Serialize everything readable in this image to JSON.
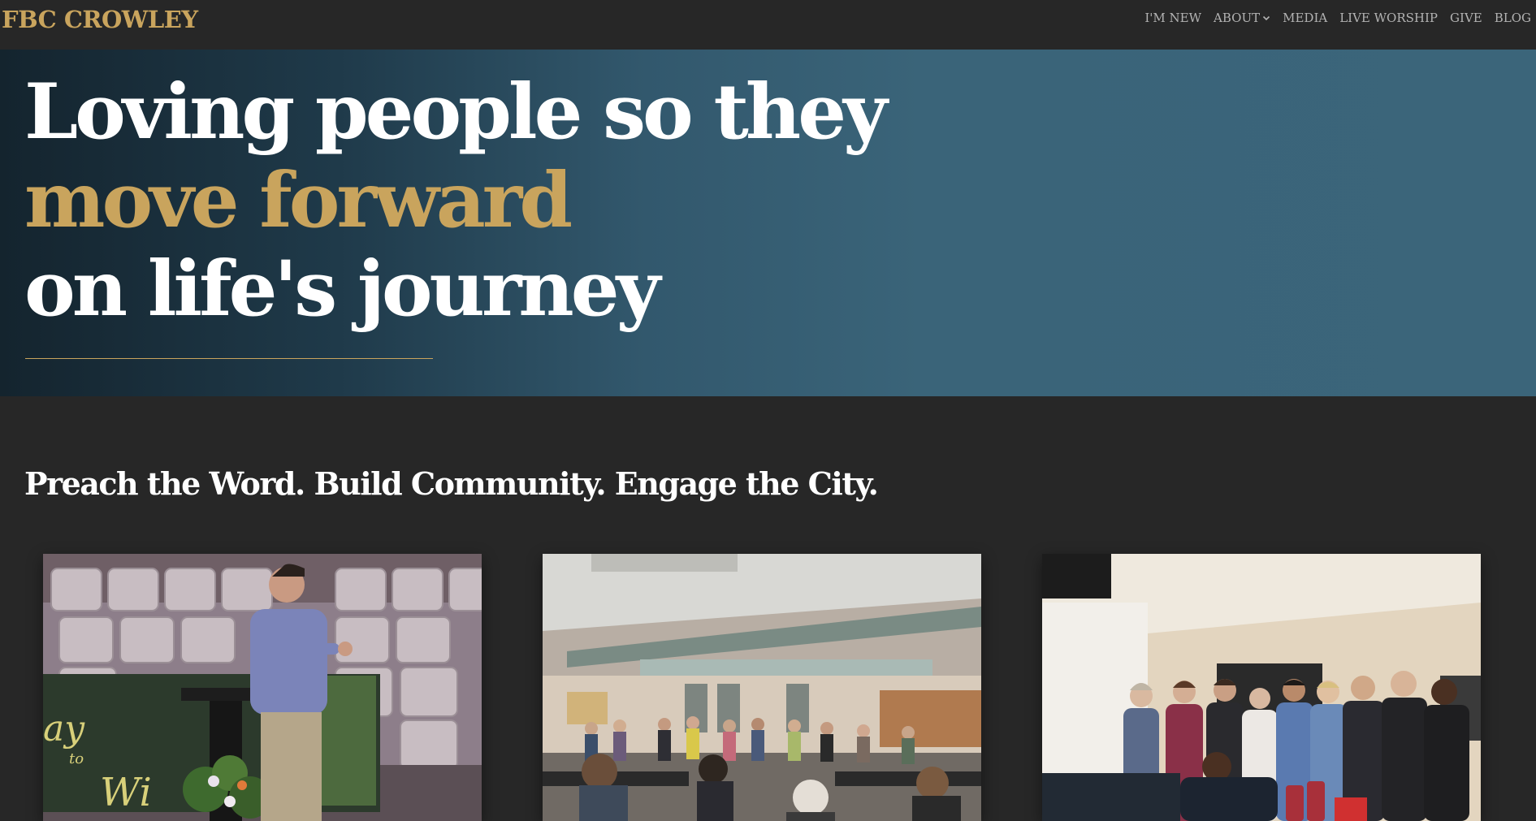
{
  "header": {
    "logo": "FBC CROWLEY",
    "nav": [
      {
        "label": "I'M NEW"
      },
      {
        "label": "ABOUT",
        "has_dropdown": true
      },
      {
        "label": "MEDIA"
      },
      {
        "label": "LIVE WORSHIP"
      },
      {
        "label": "GIVE"
      },
      {
        "label": "BLOG"
      }
    ]
  },
  "hero": {
    "line1": "Loving people so they",
    "line2": "move forward",
    "line3": "on life's journey"
  },
  "tagline": "Preach the Word.  Build Community. Engage the City.",
  "photos": [
    {
      "subject": "pastor-preaching-photo",
      "banner_text": "Way to Wi"
    },
    {
      "subject": "fellowship-hall-gathering-photo"
    },
    {
      "subject": "group-photo"
    }
  ],
  "colors": {
    "background": "#272727",
    "accent_gold": "#c9a45d",
    "hero_blue": "#3b657a",
    "nav_text": "#b3b3b3"
  }
}
